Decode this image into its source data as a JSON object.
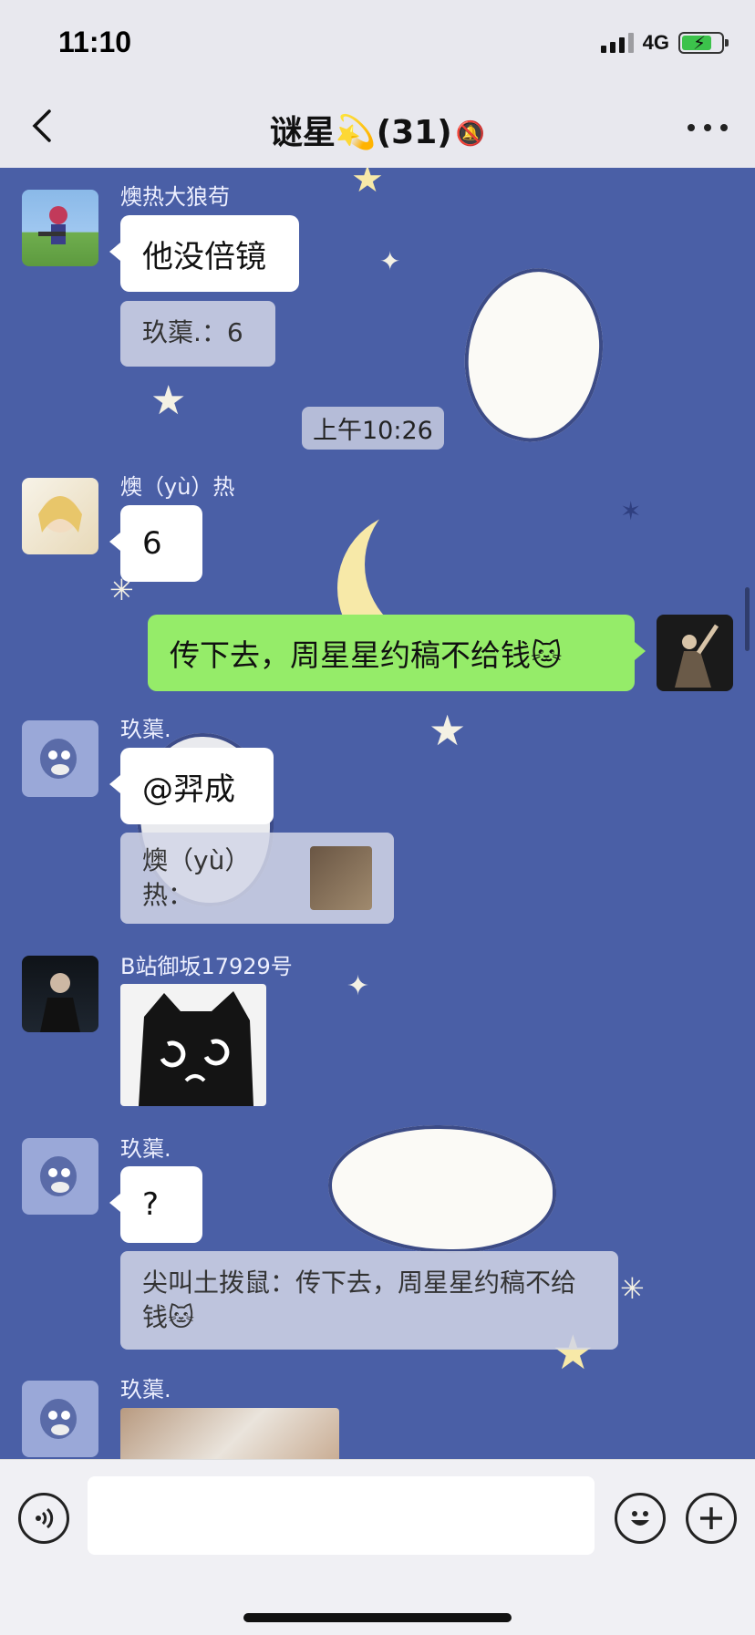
{
  "status": {
    "time": "11:10",
    "network": "4G"
  },
  "header": {
    "title": "谜星💫(31)"
  },
  "messages": {
    "m1_sender": "燠热大狼苟",
    "m1_text": "他没倍镜",
    "m1_quote": "玖蕖.：6",
    "timestamp": "上午10:26",
    "m2_sender": "燠（yù）热",
    "m2_text": "6",
    "self_text": "传下去，周星星约稿不给钱🐱",
    "m3_sender": "玖蕖.",
    "m3_text": "@羿成",
    "m3_quote": "燠（yù）热：",
    "m4_sender": "B站御坂17929号",
    "m5_sender": "玖蕖.",
    "m5_text": "?",
    "m5_quote": "尖叫土拨鼠：传下去，周星星约稿不给钱🐱",
    "m6_sender": "玖蕖."
  },
  "colors": {
    "chat_bg": "#4a5fa6",
    "self_bubble": "#95ec69"
  },
  "icons": [
    "chevron-left-icon",
    "mute-bell-icon",
    "more-icon",
    "voice-icon",
    "emoji-icon",
    "plus-icon"
  ]
}
